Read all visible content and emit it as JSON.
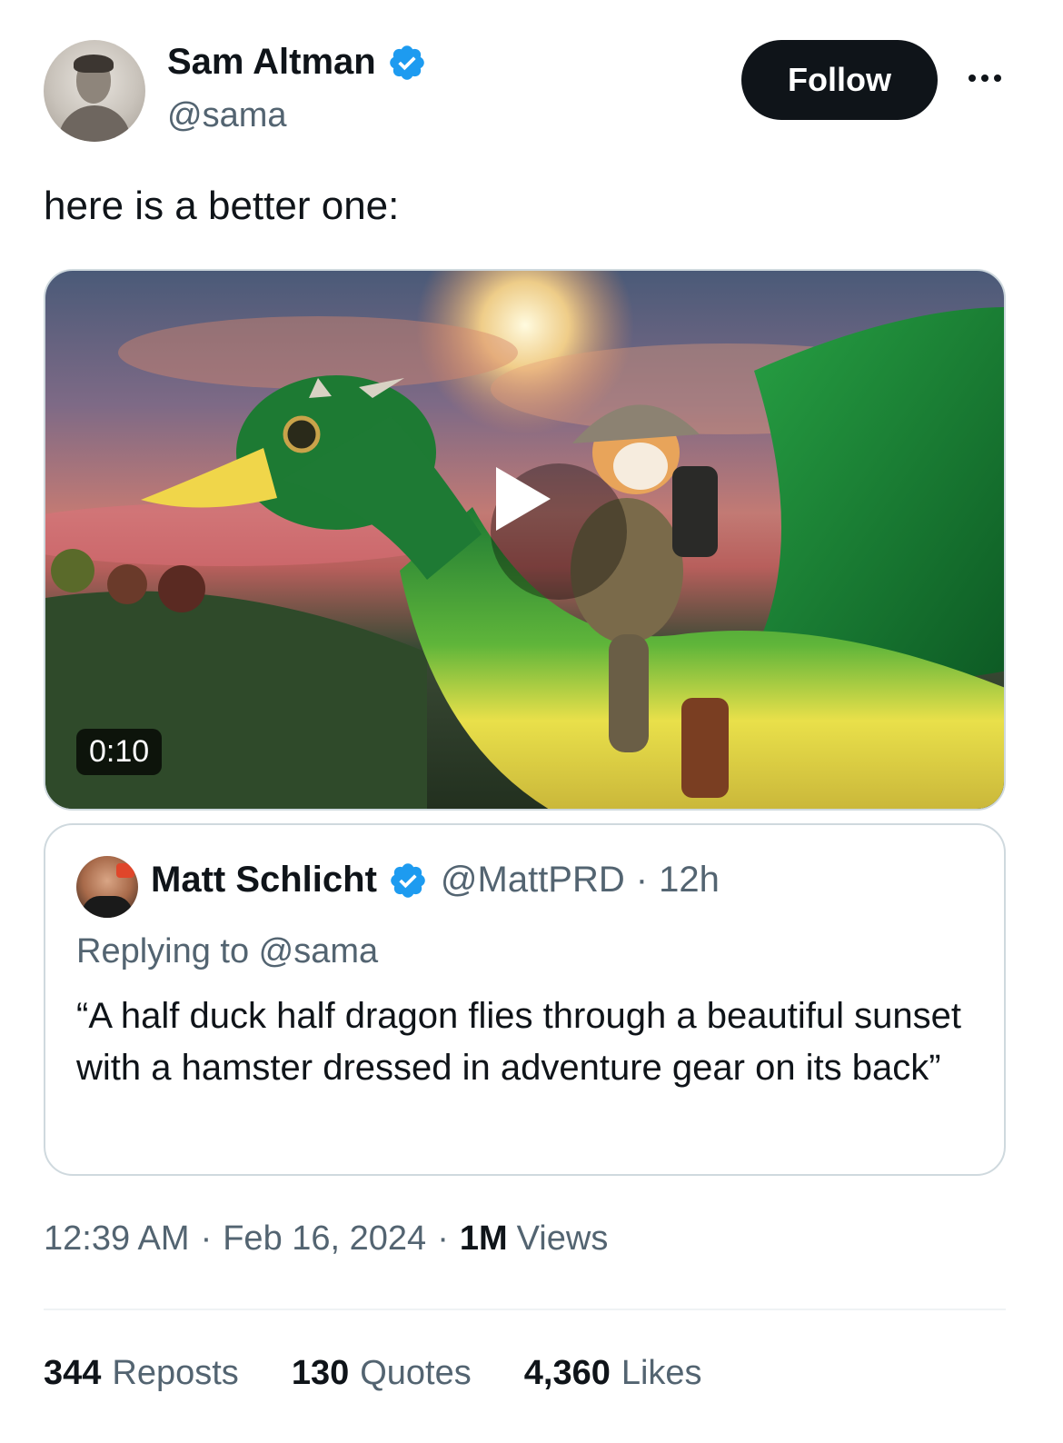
{
  "author": {
    "name": "Sam Altman",
    "handle": "@sama",
    "verified": true
  },
  "follow_label": "Follow",
  "tweet_text": "here is a better one:",
  "media": {
    "duration": "0:10",
    "colors": {
      "sky": "#c27a74",
      "duck_green": "#1f8a3a",
      "beak": "#f0d64a"
    }
  },
  "quoted": {
    "name": "Matt Schlicht",
    "handle": "@MattPRD",
    "separator": "·",
    "time": "12h",
    "replying_to": "Replying to @sama",
    "text": "“A half duck half dragon flies through a beautiful sunset with a hamster dressed in adventure gear on its back”"
  },
  "meta": {
    "time": "12:39 AM",
    "sep1": "·",
    "date": "Feb 16, 2024",
    "sep2": "·",
    "views_count": "1M",
    "views_label": "Views"
  },
  "stats": [
    {
      "num": "344",
      "label": "Reposts"
    },
    {
      "num": "130",
      "label": "Quotes"
    },
    {
      "num": "4,360",
      "label": "Likes"
    }
  ],
  "colors": {
    "text": "#0f1419",
    "secondary": "#536471",
    "verified": "#1d9bf0",
    "border": "#cfd9de"
  }
}
